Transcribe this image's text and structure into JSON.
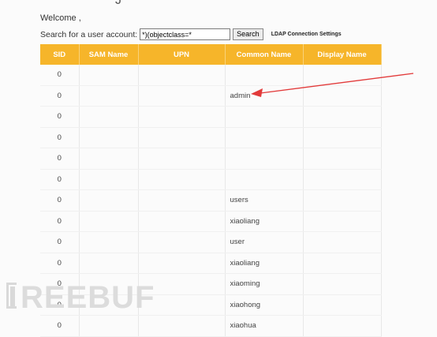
{
  "header": {
    "welcome": "Welcome ,",
    "top_glyph": "J"
  },
  "search": {
    "label": "Search for a user account:",
    "value": "*)(objectclass=*",
    "button": "Search",
    "settings_link": "LDAP Connection Settings"
  },
  "table": {
    "headers": [
      "SID",
      "SAM Name",
      "UPN",
      "Common Name",
      "Display Name"
    ],
    "rows": [
      {
        "sid": "0",
        "cn": ""
      },
      {
        "sid": "0",
        "cn": "admin"
      },
      {
        "sid": "0",
        "cn": ""
      },
      {
        "sid": "0",
        "cn": ""
      },
      {
        "sid": "0",
        "cn": ""
      },
      {
        "sid": "0",
        "cn": ""
      },
      {
        "sid": "0",
        "cn": "users"
      },
      {
        "sid": "0",
        "cn": "xiaoliang"
      },
      {
        "sid": "0",
        "cn": "user"
      },
      {
        "sid": "0",
        "cn": "xiaoliang"
      },
      {
        "sid": "0",
        "cn": "xiaoming"
      },
      {
        "sid": "0",
        "cn": "xiaohong"
      },
      {
        "sid": "0",
        "cn": "xiaohua"
      }
    ]
  },
  "colors": {
    "header_bg": "#f6b52a",
    "annotation_arrow": "#e23a3a"
  },
  "watermark": {
    "text": "FREEBUF"
  }
}
